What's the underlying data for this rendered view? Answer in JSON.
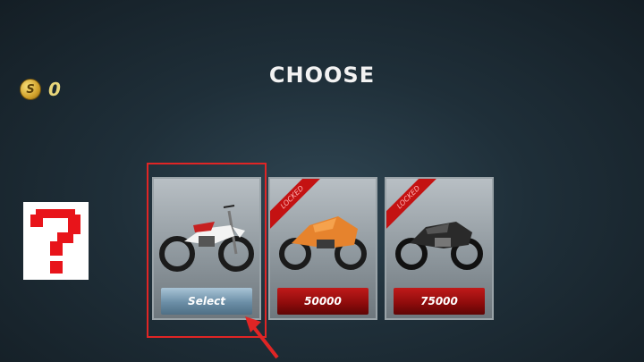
{
  "coins": {
    "icon_label": "S",
    "amount": "0"
  },
  "title": "CHOOSE",
  "mystery_icon": "question-mark-icon",
  "bikes": [
    {
      "button": "Select",
      "locked": false,
      "colors": {
        "body": "#f3f3f3",
        "accent": "#c62020"
      }
    },
    {
      "button": "50000",
      "locked": true,
      "ribbon": "LOCKED",
      "colors": {
        "body": "#e6832d",
        "accent": "#3a3a3a"
      }
    },
    {
      "button": "75000",
      "locked": true,
      "ribbon": "LOCKED",
      "colors": {
        "body": "#2a2a2a",
        "accent": "#555555"
      }
    }
  ],
  "highlight_color": "#e02525"
}
